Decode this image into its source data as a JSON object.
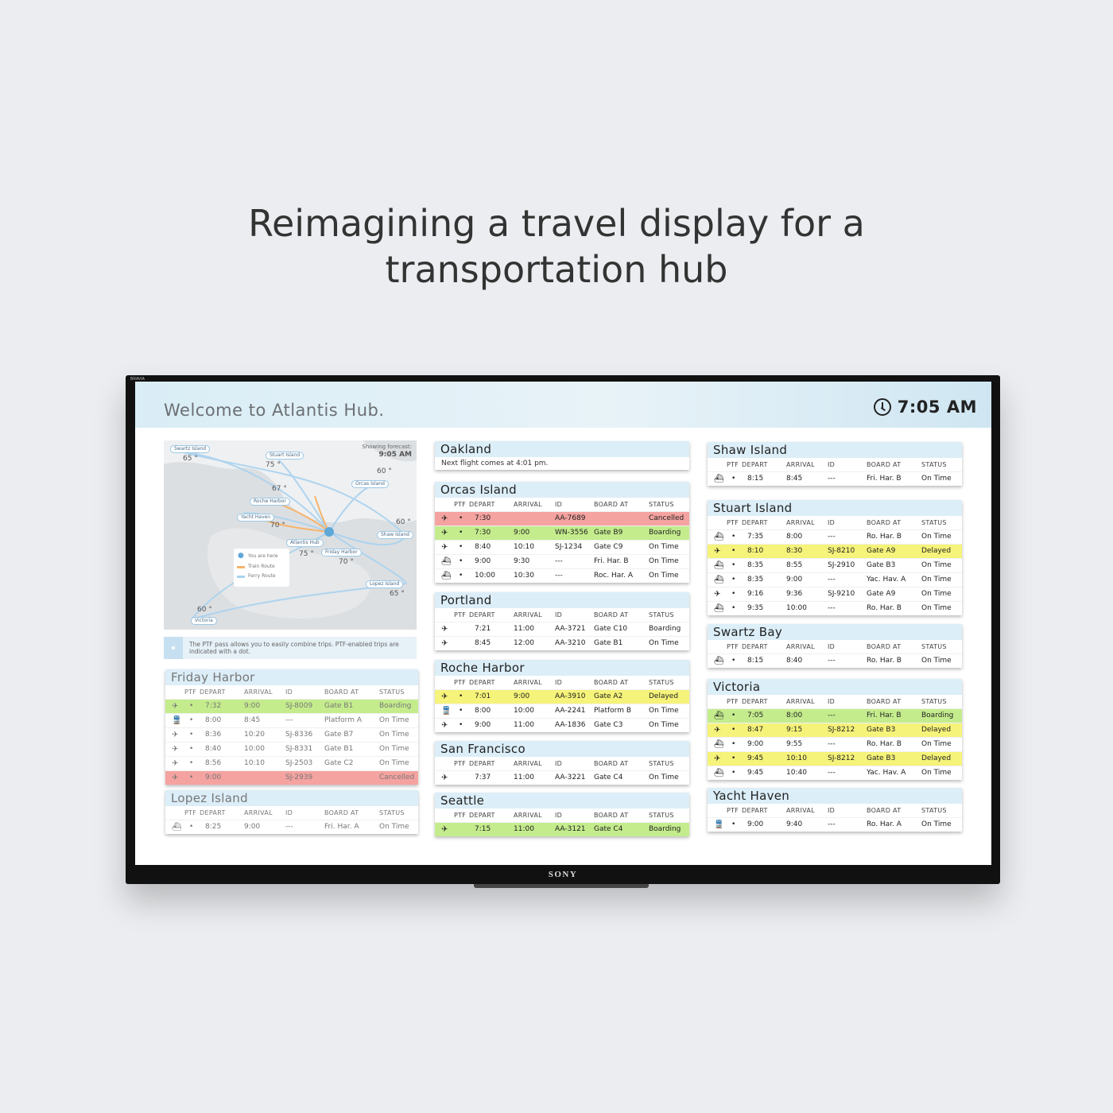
{
  "page": {
    "headline_line1": "Reimagining a travel display for a",
    "headline_line2": "transportation hub"
  },
  "tv": {
    "brand_top": "BRAVIA",
    "brand_bottom": "SONY"
  },
  "header": {
    "welcome": "Welcome to Atlantis Hub.",
    "clock_icon": "clock-icon",
    "time": "7:05 AM"
  },
  "columns": {
    "ptf": "PTF",
    "depart": "DEPART",
    "arrival": "ARRIVAL",
    "id": "ID",
    "board_at": "BOARD AT",
    "status": "STATUS"
  },
  "map": {
    "forecast_label": "Showing forecast:",
    "forecast_time": "9:05 AM",
    "places": [
      "Swartz Island",
      "Stuart Island",
      "Orcas Island",
      "Roche Harbor",
      "Yacht Haven",
      "Shaw Island",
      "Atlantis Hub",
      "Friday Harbor",
      "Lopez Island",
      "Victoria"
    ],
    "temps": [
      "65 °",
      "75 °",
      "60 °",
      "67 °",
      "70 °",
      "60 °",
      "75 °",
      "70 °",
      "65 °",
      "60 °"
    ],
    "legend": {
      "you_are_here": "You are here",
      "train_route": "Train Route",
      "ferry_route": "Ferry Route"
    },
    "colors": {
      "ferry": "#a9d2ef",
      "train": "#f6b46c",
      "land": "#dcdfe2",
      "water": "#eef0f2"
    }
  },
  "ptf_note": "The PTF pass allows you to easily combine trips. PTF-enabled trips are indicated with a dot.",
  "colors": {
    "cancelled": "#f4a3a0",
    "boarding": "#c4ec8d",
    "delayed": "#f6f37a",
    "title_bar": "#dceef8"
  },
  "icons": {
    "plane": "✈",
    "ferry": "⛴",
    "train": "🚆"
  },
  "cards": [
    {
      "title": "Oakland",
      "subtitle": "Next flight comes at 4:01 pm.",
      "rows": []
    },
    {
      "title": "Orcas Island",
      "rows": [
        {
          "icon": "✈",
          "ptf": "•",
          "depart": "7:30",
          "arrival": "",
          "id": "AA-7689",
          "board": "",
          "status": "Cancelled",
          "hl": "red"
        },
        {
          "icon": "✈",
          "ptf": "•",
          "depart": "7:30",
          "arrival": "9:00",
          "id": "WN-3556",
          "board": "Gate B9",
          "status": "Boarding",
          "hl": "green"
        },
        {
          "icon": "✈",
          "ptf": "•",
          "depart": "8:40",
          "arrival": "10:10",
          "id": "SJ-1234",
          "board": "Gate C9",
          "status": "On Time",
          "hl": ""
        },
        {
          "icon": "⛴",
          "ptf": "•",
          "depart": "9:00",
          "arrival": "9:30",
          "id": "---",
          "board": "Fri. Har. B",
          "status": "On Time",
          "hl": ""
        },
        {
          "icon": "⛴",
          "ptf": "•",
          "depart": "10:00",
          "arrival": "10:30",
          "id": "---",
          "board": "Roc. Har. A",
          "status": "On Time",
          "hl": ""
        }
      ]
    },
    {
      "title": "Portland",
      "rows": [
        {
          "icon": "✈",
          "ptf": "",
          "depart": "7:21",
          "arrival": "11:00",
          "id": "AA-3721",
          "board": "Gate C10",
          "status": "Boarding",
          "hl": ""
        },
        {
          "icon": "✈",
          "ptf": "",
          "depart": "8:45",
          "arrival": "12:00",
          "id": "AA-3210",
          "board": "Gate B1",
          "status": "On Time",
          "hl": ""
        }
      ]
    },
    {
      "title": "Roche Harbor",
      "rows": [
        {
          "icon": "✈",
          "ptf": "•",
          "depart": "7:01",
          "arrival": "9:00",
          "id": "AA-3910",
          "board": "Gate A2",
          "status": "Delayed",
          "hl": "yellow"
        },
        {
          "icon": "🚆",
          "ptf": "•",
          "depart": "8:00",
          "arrival": "10:00",
          "id": "AA-2241",
          "board": "Platform B",
          "status": "On Time",
          "hl": ""
        },
        {
          "icon": "✈",
          "ptf": "•",
          "depart": "9:00",
          "arrival": "11:00",
          "id": "AA-1836",
          "board": "Gate C3",
          "status": "On Time",
          "hl": ""
        }
      ]
    },
    {
      "title": "San Francisco",
      "rows": [
        {
          "icon": "✈",
          "ptf": "",
          "depart": "7:37",
          "arrival": "11:00",
          "id": "AA-3221",
          "board": "Gate C4",
          "status": "On Time",
          "hl": ""
        }
      ]
    },
    {
      "title": "Seattle",
      "rows": [
        {
          "icon": "✈",
          "ptf": "",
          "depart": "7:15",
          "arrival": "11:00",
          "id": "AA-3121",
          "board": "Gate C4",
          "status": "Boarding",
          "hl": "green"
        }
      ]
    },
    {
      "title": "Shaw Island",
      "rows": [
        {
          "icon": "⛴",
          "ptf": "•",
          "depart": "8:15",
          "arrival": "8:45",
          "id": "---",
          "board": "Fri. Har. B",
          "status": "On Time",
          "hl": ""
        }
      ]
    },
    {
      "title": "Stuart Island",
      "rows": [
        {
          "icon": "⛴",
          "ptf": "•",
          "depart": "7:35",
          "arrival": "8:00",
          "id": "---",
          "board": "Ro. Har. B",
          "status": "On Time",
          "hl": ""
        },
        {
          "icon": "✈",
          "ptf": "•",
          "depart": "8:10",
          "arrival": "8:30",
          "id": "SJ-8210",
          "board": "Gate A9",
          "status": "Delayed",
          "hl": "yellow"
        },
        {
          "icon": "⛴",
          "ptf": "•",
          "depart": "8:35",
          "arrival": "8:55",
          "id": "SJ-2910",
          "board": "Gate B3",
          "status": "On Time",
          "hl": ""
        },
        {
          "icon": "⛴",
          "ptf": "•",
          "depart": "8:35",
          "arrival": "9:00",
          "id": "---",
          "board": "Yac. Hav. A",
          "status": "On Time",
          "hl": ""
        },
        {
          "icon": "✈",
          "ptf": "•",
          "depart": "9:16",
          "arrival": "9:36",
          "id": "SJ-9210",
          "board": "Gate A9",
          "status": "On Time",
          "hl": ""
        },
        {
          "icon": "⛴",
          "ptf": "•",
          "depart": "9:35",
          "arrival": "10:00",
          "id": "---",
          "board": "Ro. Har. B",
          "status": "On Time",
          "hl": ""
        }
      ]
    },
    {
      "title": "Swartz Bay",
      "rows": [
        {
          "icon": "⛴",
          "ptf": "•",
          "depart": "8:15",
          "arrival": "8:40",
          "id": "---",
          "board": "Ro. Har. B",
          "status": "On Time",
          "hl": ""
        }
      ]
    },
    {
      "title": "Victoria",
      "rows": [
        {
          "icon": "⛴",
          "ptf": "•",
          "depart": "7:05",
          "arrival": "8:00",
          "id": "---",
          "board": "Fri. Har. B",
          "status": "Boarding",
          "hl": "green"
        },
        {
          "icon": "✈",
          "ptf": "•",
          "depart": "8:47",
          "arrival": "9:15",
          "id": "SJ-8212",
          "board": "Gate B3",
          "status": "Delayed",
          "hl": "yellow"
        },
        {
          "icon": "⛴",
          "ptf": "•",
          "depart": "9:00",
          "arrival": "9:55",
          "id": "---",
          "board": "Ro. Har. B",
          "status": "On Time",
          "hl": ""
        },
        {
          "icon": "✈",
          "ptf": "•",
          "depart": "9:45",
          "arrival": "10:10",
          "id": "SJ-8212",
          "board": "Gate B3",
          "status": "Delayed",
          "hl": "yellow"
        },
        {
          "icon": "⛴",
          "ptf": "•",
          "depart": "9:45",
          "arrival": "10:40",
          "id": "---",
          "board": "Yac. Hav. A",
          "status": "On Time",
          "hl": ""
        }
      ]
    },
    {
      "title": "Yacht Haven",
      "rows": [
        {
          "icon": "🚆",
          "ptf": "•",
          "depart": "9:00",
          "arrival": "9:40",
          "id": "---",
          "board": "Ro. Har. A",
          "status": "On Time",
          "hl": ""
        }
      ]
    },
    {
      "title": "Friday Harbor",
      "dim": true,
      "rows": [
        {
          "icon": "✈",
          "ptf": "•",
          "depart": "7:32",
          "arrival": "9:00",
          "id": "SJ-8009",
          "board": "Gate B1",
          "status": "Boarding",
          "hl": "green"
        },
        {
          "icon": "🚆",
          "ptf": "•",
          "depart": "8:00",
          "arrival": "8:45",
          "id": "---",
          "board": "Platform A",
          "status": "On Time",
          "hl": ""
        },
        {
          "icon": "✈",
          "ptf": "•",
          "depart": "8:36",
          "arrival": "10:20",
          "id": "SJ-8336",
          "board": "Gate B7",
          "status": "On Time",
          "hl": ""
        },
        {
          "icon": "✈",
          "ptf": "•",
          "depart": "8:40",
          "arrival": "10:00",
          "id": "SJ-8331",
          "board": "Gate B1",
          "status": "On Time",
          "hl": ""
        },
        {
          "icon": "✈",
          "ptf": "•",
          "depart": "8:56",
          "arrival": "10:10",
          "id": "SJ-2503",
          "board": "Gate C2",
          "status": "On Time",
          "hl": ""
        },
        {
          "icon": "✈",
          "ptf": "•",
          "depart": "9:00",
          "arrival": "",
          "id": "SJ-2939",
          "board": "",
          "status": "Cancelled",
          "hl": "red"
        }
      ]
    },
    {
      "title": "Lopez Island",
      "dim": true,
      "rows": [
        {
          "icon": "⛴",
          "ptf": "•",
          "depart": "8:25",
          "arrival": "9:00",
          "id": "---",
          "board": "Fri. Har. A",
          "status": "On Time",
          "hl": ""
        }
      ]
    }
  ]
}
